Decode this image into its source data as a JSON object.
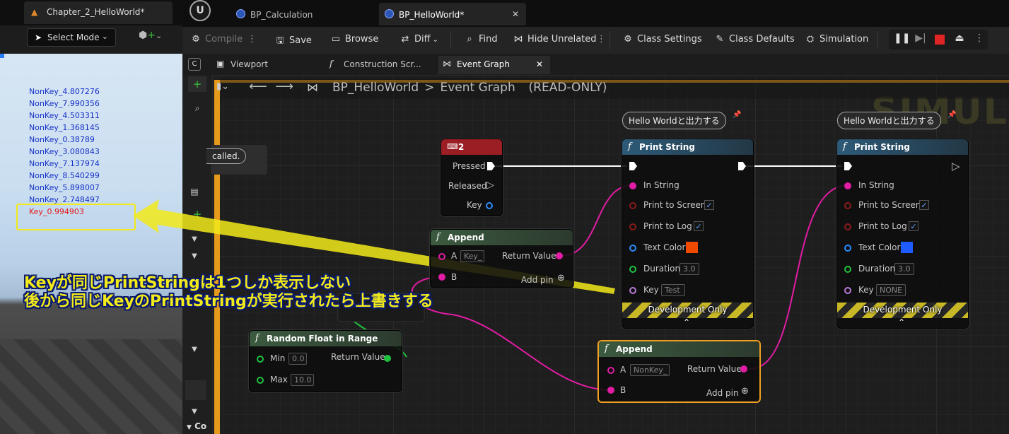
{
  "left_panel": {
    "tab_label": "Chapter_2_HelloWorld*",
    "select_mode_label": "Select Mode",
    "log_lines": [
      {
        "text": "NonKey_4.807276",
        "type": "nonkey"
      },
      {
        "text": "NonKey_7.990356",
        "type": "nonkey"
      },
      {
        "text": "NonKey_4.503311",
        "type": "nonkey"
      },
      {
        "text": "NonKey_1.368145",
        "type": "nonkey"
      },
      {
        "text": "NonKey_0.38789",
        "type": "nonkey"
      },
      {
        "text": "NonKey_3.080843",
        "type": "nonkey"
      },
      {
        "text": "NonKey_7.137974",
        "type": "nonkey"
      },
      {
        "text": "NonKey_8.540299",
        "type": "nonkey"
      },
      {
        "text": "NonKey_5.898007",
        "type": "nonkey"
      },
      {
        "text": "NonKey_2.748497",
        "type": "nonkey"
      },
      {
        "text": "Key_0.994903",
        "type": "key"
      }
    ],
    "nonkey_color": "#1530c8",
    "key_color": "#e21a1a"
  },
  "doc_tabs": [
    {
      "label": "BP_Calculation",
      "active": false
    },
    {
      "label": "BP_HelloWorld*",
      "active": true
    }
  ],
  "toolbar": {
    "compile": "Compile",
    "save": "Save",
    "browse": "Browse",
    "diff": "Diff",
    "find": "Find",
    "hide_unrelated": "Hide Unrelated",
    "class_settings": "Class Settings",
    "class_defaults": "Class Defaults",
    "simulation": "Simulation"
  },
  "graph_tabs": [
    {
      "label": "Viewport"
    },
    {
      "label": "Construction Scr..."
    },
    {
      "label": "Event Graph"
    }
  ],
  "breadcrumb": {
    "blueprint": "BP_HelloWorld",
    "graph": "Event Graph",
    "mode": "(READ-ONLY)"
  },
  "watermark": "SIMULA",
  "partial_comment": "called.",
  "nodes": {
    "key_event": {
      "title": "2",
      "pressed": "Pressed",
      "released": "Released",
      "key": "Key",
      "header_color": "#9a1e24"
    },
    "append1": {
      "title": "Append",
      "a_label": "A",
      "a_value": "Key_",
      "b_label": "B",
      "return_label": "Return Value",
      "add_pin": "Add pin",
      "header_color": "#3b5a3f"
    },
    "random": {
      "title": "Random Float in Range",
      "min_label": "Min",
      "min_value": "0.0",
      "max_label": "Max",
      "max_value": "10.0",
      "return_label": "Return Value",
      "header_color": "#3b5a3f"
    },
    "append2": {
      "title": "Append",
      "a_label": "A",
      "a_value": "NonKey_",
      "b_label": "B",
      "return_label": "Return Value",
      "add_pin": "Add pin",
      "header_color": "#3b5a3f"
    },
    "print1": {
      "comment": "Hello Worldと出力する",
      "title": "Print String",
      "in_string": "In String",
      "print_to_screen": "Print to Screen",
      "print_to_log": "Print to Log",
      "text_color": "Text Color",
      "text_color_value": "#f04a00",
      "duration": "Duration",
      "duration_value": "3.0",
      "key": "Key",
      "key_value": "Test",
      "dev_only": "Development Only",
      "header_color": "#2d5a78"
    },
    "print2": {
      "comment": "Hello Worldと出力する",
      "title": "Print String",
      "in_string": "In String",
      "print_to_screen": "Print to Screen",
      "print_to_log": "Print to Log",
      "text_color": "Text Color",
      "text_color_value": "#1e5cff",
      "duration": "Duration",
      "duration_value": "3.0",
      "key": "Key",
      "key_value": "NONE",
      "dev_only": "Development Only",
      "header_color": "#2d5a78"
    }
  },
  "annotation": {
    "line1": "Keyが同じPrintStringは1つしか表示しない",
    "line2": "後から同じKeyのPrintStringが実行されたら上書きする",
    "text_color": "#f2ea1a"
  },
  "side_panel_fragment": "Co"
}
